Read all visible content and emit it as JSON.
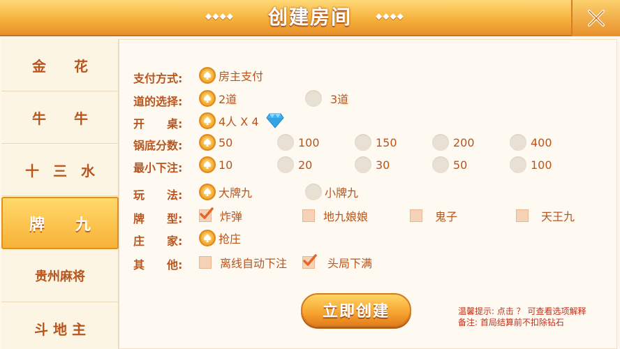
{
  "header": {
    "title": "创建房间",
    "deco_left": "◆◆◆◆",
    "deco_right": "◆◆◆◆",
    "close_icon": "close-x-icon"
  },
  "sidebar": {
    "tabs": [
      {
        "label": "金　　花",
        "active": false
      },
      {
        "label": "牛　　牛",
        "active": false
      },
      {
        "label": "十　三　水",
        "active": false
      },
      {
        "label": "牌　　九",
        "active": true
      },
      {
        "label": "贵州麻将",
        "active": false
      },
      {
        "label": "斗 地 主",
        "active": false
      }
    ]
  },
  "form": {
    "payment": {
      "label": "支付方式:",
      "options": [
        "房主支付"
      ],
      "selected": "房主支付"
    },
    "lanes": {
      "label": "道的选择:",
      "options": [
        "2道",
        "3道"
      ],
      "selected": "2道"
    },
    "table": {
      "label": "开　　桌:",
      "value": "4人 X 4",
      "icon": "diamond-icon"
    },
    "base_score": {
      "label": "锅底分数:",
      "options": [
        "50",
        "100",
        "150",
        "200",
        "400"
      ],
      "selected": "50"
    },
    "min_bet": {
      "label": "最小下注:",
      "options": [
        "10",
        "20",
        "30",
        "50",
        "100"
      ],
      "selected": "10"
    },
    "play": {
      "label": "玩　　法:",
      "options": [
        "大牌九",
        "小牌九"
      ],
      "selected": "大牌九"
    },
    "card_type": {
      "label": "牌　　型:",
      "options": [
        "炸弹",
        "地九娘娘",
        "鬼子",
        "天王九"
      ],
      "checked": [
        "炸弹"
      ]
    },
    "banker": {
      "label": "庄　　家:",
      "options": [
        "抢庄"
      ],
      "selected": "抢庄"
    },
    "other": {
      "label": "其　　他:",
      "options": [
        "离线自动下注",
        "头局下满"
      ],
      "checked": [
        "头局下满"
      ]
    }
  },
  "create_button": "立即创建",
  "notes": {
    "tip": "温馨提示: 点击 ？ 可查看选项解释",
    "remark": "备注: 首局结算前不扣除钻石"
  },
  "colors": {
    "accent": "#f7a331",
    "text": "#b8541c",
    "note": "#c0301c"
  }
}
